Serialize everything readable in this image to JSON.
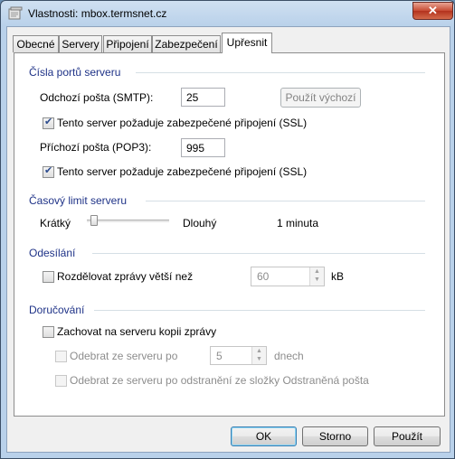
{
  "window": {
    "title": "Vlastnosti: mbox.termsnet.cz",
    "close_label": "✕"
  },
  "tabs": [
    {
      "label": "Obecné"
    },
    {
      "label": "Servery"
    },
    {
      "label": "Připojení"
    },
    {
      "label": "Zabezpečení"
    },
    {
      "label": "Upřesnit",
      "active": true
    }
  ],
  "ports": {
    "group_label": "Čísla portů serveru",
    "smtp_label": "Odchozí pošta (SMTP):",
    "smtp_value": "25",
    "default_button": "Použít výchozí",
    "smtp_ssl_label": "Tento server požaduje zabezpečené připojení (SSL)",
    "smtp_ssl_checked": true,
    "pop3_label": "Příchozí pošta (POP3):",
    "pop3_value": "995",
    "pop3_ssl_label": "Tento server požaduje zabezpečené připojení (SSL)",
    "pop3_ssl_checked": true
  },
  "timeout": {
    "group_label": "Časový limit serveru",
    "short_label": "Krátký",
    "long_label": "Dlouhý",
    "value_label": "1 minuta",
    "slider_fraction": 0.0
  },
  "sending": {
    "group_label": "Odesílání",
    "split_label": "Rozdělovat zprávy větší než",
    "split_checked": false,
    "split_value": "60",
    "split_unit": "kB"
  },
  "delivery": {
    "group_label": "Doručování",
    "keep_copy_label": "Zachovat na serveru kopii zprávy",
    "keep_copy_checked": false,
    "remove_after_label": "Odebrat ze serveru po",
    "remove_after_value": "5",
    "remove_after_unit": "dnech",
    "remove_deleted_label": "Odebrat ze serveru po odstranění ze složky Odstraněná pošta"
  },
  "buttons": {
    "ok": "OK",
    "cancel": "Storno",
    "apply": "Použít"
  }
}
